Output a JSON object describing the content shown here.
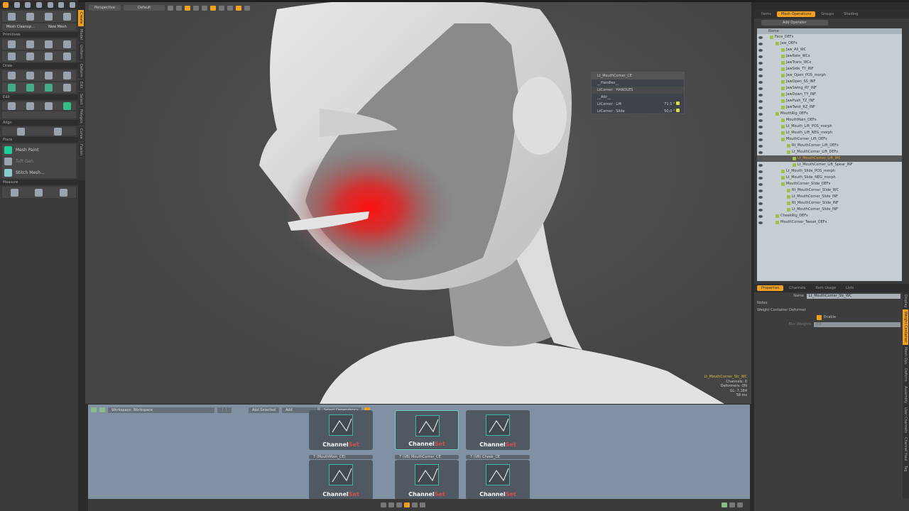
{
  "left_toolbar": {
    "buttons": [
      "Mesh Cleanup...",
      "New Mesh"
    ],
    "sections": [
      "Primitives",
      "Draw",
      "Edit",
      "Align",
      "Place",
      "Measure"
    ],
    "place_items": [
      "Mesh Paint",
      "Tuft Gen",
      "Stitch Mesh..."
    ]
  },
  "left_vtabs": [
    "Create",
    "Model",
    "Uniform",
    "Deform",
    "Edit",
    "Select",
    "Polygon",
    "Curve",
    "Fusion"
  ],
  "viewport": {
    "view": "Perspective",
    "shading": "Default",
    "overlay": {
      "title": "Lt_MouthCorner_CE",
      "group1": "__Handles__",
      "handle": "LtCorner : HANDLES",
      "group2": "__Attr__",
      "rows": [
        {
          "label": "LtCorner : Lift",
          "value": "71.5 °"
        },
        {
          "label": "LtCorner : Slide",
          "value": "50.0 °"
        }
      ]
    },
    "info": {
      "item": "Lt_MouthCorner_Slc_WC",
      "lines": [
        "Channels: 0",
        "Deformers: ON",
        "GL: 7,184",
        "58 ms"
      ]
    }
  },
  "right_panel": {
    "tabs": [
      "Items",
      "Mesh Operations",
      "Groups",
      "Shading"
    ],
    "filter": "Add Operator",
    "column": "Name",
    "tree": [
      [
        "Face_DEFs",
        1
      ],
      [
        "Jaw_DEFs",
        2
      ],
      [
        "Jaw_All_WC",
        3
      ],
      [
        "JawRate_WCs",
        3
      ],
      [
        "JawTrans_WCs",
        3
      ],
      [
        "JawSide_TY_INF",
        3
      ],
      [
        "Jaw_Open_POS_morph",
        3
      ],
      [
        "JawOpen_SS_INF",
        3
      ],
      [
        "JawSwing_RY_INF",
        3
      ],
      [
        "JawDown_TY_INF",
        3
      ],
      [
        "JawPush_TZ_INF",
        3
      ],
      [
        "JawTwist_RZ_INF",
        3
      ],
      [
        "MouthRig_DEFs",
        2
      ],
      [
        "MouthMain_DEFs",
        3
      ],
      [
        "Lt_Mouth_Lift_POS_morph",
        3
      ],
      [
        "Lt_Mouth_Lift_NEG_morph",
        3
      ],
      [
        "MouthCorner_Lift_DEFs",
        3
      ],
      [
        "Rt_MouthCorner_Lift_DEFs",
        4
      ],
      [
        "Lt_MouthCorner_Lift_DEFs",
        4
      ],
      [
        "Lt_MouthCorner_Lift_WC",
        5
      ],
      [
        "Lt_MouthCorner_Lift_Spear_INF",
        5
      ],
      [
        "Lt_Mouth_Slide_POS_morph",
        3
      ],
      [
        "Lt_Mouth_Slide_NEG_morph",
        3
      ],
      [
        "MouthCorner_Slide_DEFs",
        3
      ],
      [
        "Rt_MouthCorner_Slide_WC",
        4
      ],
      [
        "Lt_MouthCorner_Slide_INF",
        4
      ],
      [
        "Rt_MouthCorner_Slide_INF",
        4
      ],
      [
        "Lt_MouthCorner_Slide_INF",
        4
      ],
      [
        "CheekRig_DEFs",
        2
      ],
      [
        "MouthCorner_Tweak_DEFs",
        2
      ]
    ],
    "selected_index": 19
  },
  "properties": {
    "tabs": [
      "Properties",
      "Channels",
      "Item Usage",
      "Lists"
    ],
    "name_label": "Name",
    "name_value": "Lt_MouthCorner_Slc_WC",
    "notes": "Notes",
    "section": "Weight Container Deformer",
    "enable": "Enable",
    "enable_checked": true,
    "blend_label": "Blur Weights",
    "blend_value": "0.0"
  },
  "right_vtabs": [
    "Display",
    "Weight Container",
    "Mesh Ops",
    "Deform",
    "Assembly",
    "User Channels",
    "Channel Haul",
    "Tag"
  ],
  "node_editor": {
    "workspace": "Workspace: Workspace",
    "add_selected": "Add Selected",
    "add": "Add",
    "select_dep": "Select Dependency",
    "cards": [
      {
        "title": "",
        "label": "Channel",
        "suffix": "Set"
      },
      {
        "title": "",
        "label": "Channel",
        "suffix": "Set",
        "selected": true
      },
      {
        "title": "",
        "label": "Channel",
        "suffix": "Set"
      },
      {
        "title": "7 (MouthMain_CE)",
        "label": "Channel",
        "suffix": "Set"
      },
      {
        "title": "7 (VB) MouthCorner_CE",
        "label": "Channel",
        "suffix": "Set"
      },
      {
        "title": "7 (VB) Cheek_CE",
        "label": "Channel",
        "suffix": "Set"
      }
    ]
  }
}
